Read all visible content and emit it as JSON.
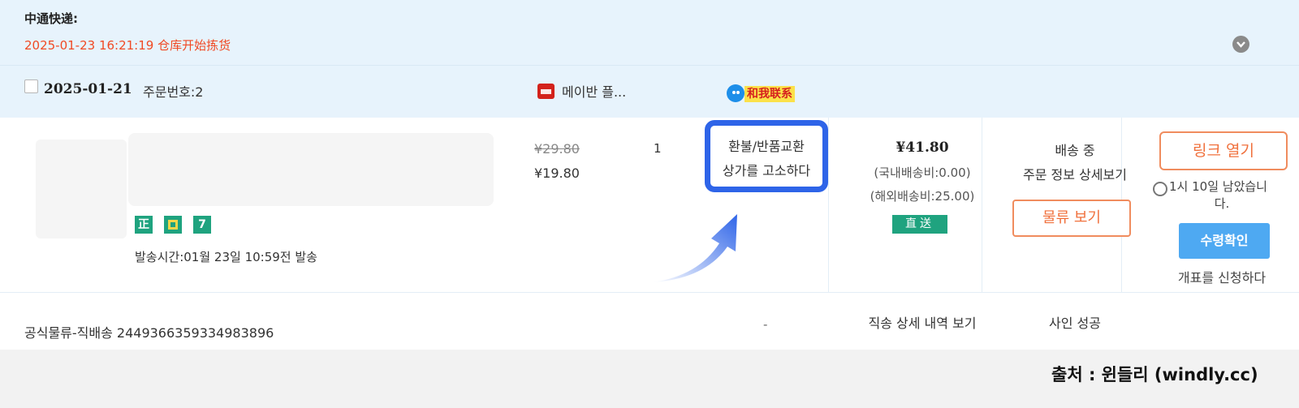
{
  "tracking": {
    "carrier_label": "中通快递:",
    "status": "2025-01-23 16:21:19 仓库开始拣货",
    "expand_icon": "chevron-down-icon"
  },
  "order": {
    "date": "2025-01-21",
    "number_label": "주문번호:2",
    "shop_name": "메이반 플...",
    "shop_icon": "tmall-icon",
    "contact_label": "和我联系"
  },
  "item": {
    "badges": [
      {
        "text": "正",
        "color": "#1fa37f"
      },
      {
        "text": "♦",
        "color": "#1fa37f"
      },
      {
        "text": "7",
        "color": "#1fa37f"
      }
    ],
    "ship_time": "발송시간:01월 23일 10:59전 발송",
    "price_original": "¥29.80",
    "price_current": "¥19.80",
    "quantity": "1",
    "refund_line1": "환불/반품교환",
    "refund_line2": "상가를 고소하다",
    "total": "¥41.80",
    "domestic_fee": "(국내배송비:0.00)",
    "overseas_fee": "(해외배송비:25.00)",
    "direct_badge": "直送",
    "shipping_status": "배송 중",
    "order_detail_link": "주문 정보 상세보기",
    "logistics_button": "물류 보기",
    "open_link_button": "링크 열기",
    "remaining_line1": "1시 10일 남았습니",
    "remaining_line2": "다.",
    "confirm_button": "수령확인",
    "invoice_link": "개표를 신청하다"
  },
  "bottom": {
    "logistics_info": "공식물류-직배송 2449366359334983896",
    "dash": "-",
    "direct_detail": "직송 상세 내역 보기",
    "sign_status": "사인 성공"
  },
  "source_credit": "출처 : 윈들리 (windly.cc)",
  "colors": {
    "highlight": "#2e64e8",
    "accent_orange": "#f0703c",
    "status_red": "#f04a24",
    "confirm_blue": "#4ea9f2"
  }
}
